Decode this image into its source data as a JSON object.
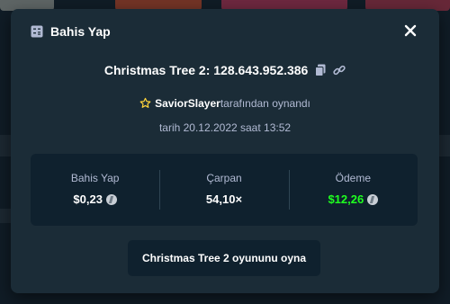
{
  "modal": {
    "title": "Bahis Yap",
    "game_title": "Christmas Tree 2: 128.643.952.386",
    "player_name": "SaviorSlayer",
    "player_suffix": "tarafından oynandı",
    "date_text": "tarih 20.12.2022 saat 13:52",
    "stats": [
      {
        "label": "Bahis Yap",
        "value": "$0,23"
      },
      {
        "label": "Çarpan",
        "value": "54,10×"
      },
      {
        "label": "Ödeme",
        "value": "$12,26"
      }
    ],
    "play_button": "Christmas Tree 2 oyununu oyna"
  },
  "colors": {
    "modal_bg": "#1b2c37",
    "inner_bg": "#0f212e",
    "payout_green": "#1fff20",
    "star_yellow": "#ffd43b",
    "muted_text": "#b1bad3"
  },
  "icons": {
    "header": "bet-slip-icon",
    "close": "close-icon",
    "copy": "copy-icon",
    "link": "link-icon",
    "star": "star-icon",
    "coin": "litecoin-icon"
  }
}
